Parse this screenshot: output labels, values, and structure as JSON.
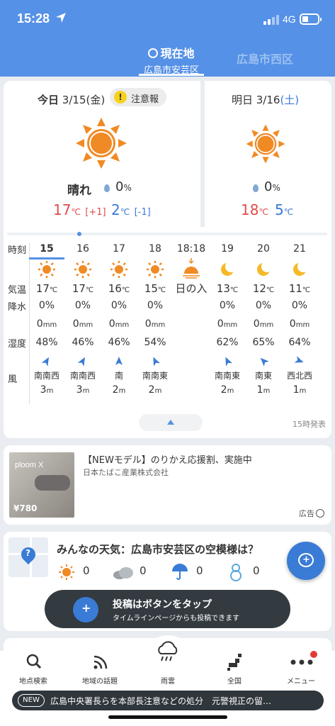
{
  "status": {
    "time": "15:28",
    "network": "4G"
  },
  "header": {
    "current_tab_title": "現在地",
    "current_tab_sub": "広島市安芸区",
    "other_tab": "広島市西区"
  },
  "today": {
    "label_bold": "今日",
    "label_date": "3/15",
    "label_dow": "(金)",
    "warning": "注意報",
    "weather": "晴れ",
    "precip": "0",
    "precip_unit": "%",
    "tmax": "17",
    "tmax_diff": "[+1]",
    "tmin": "2",
    "tmin_diff": "[-1]",
    "deg": "℃"
  },
  "tomorrow": {
    "label_prefix": "明日 3/16",
    "label_dow": "(土)",
    "precip": "0",
    "precip_unit": "%",
    "tmax": "18",
    "tmin": "5",
    "deg": "℃"
  },
  "row_labels": {
    "time": "時刻",
    "temp": "気温",
    "precip": "降水",
    "humidity": "湿度",
    "wind": "風"
  },
  "hours": [
    {
      "time": "15",
      "icon": "sun-icon",
      "temp": "17",
      "precip": "0%",
      "rain": "0",
      "humidity": "48%",
      "wind_dir": "南南西",
      "wind_speed": "3",
      "arrow_deg": 30
    },
    {
      "time": "16",
      "icon": "sun-icon",
      "temp": "17",
      "precip": "0%",
      "rain": "0",
      "humidity": "46%",
      "wind_dir": "南南西",
      "wind_speed": "3",
      "arrow_deg": 30
    },
    {
      "time": "17",
      "icon": "sun-icon",
      "temp": "16",
      "precip": "0%",
      "rain": "0",
      "humidity": "46%",
      "wind_dir": "南",
      "wind_speed": "2",
      "arrow_deg": 0
    },
    {
      "time": "18",
      "icon": "sun-icon",
      "temp": "15",
      "precip": "0%",
      "rain": "0",
      "humidity": "54%",
      "wind_dir": "南南東",
      "wind_speed": "2",
      "arrow_deg": -25
    },
    {
      "time": "18:18",
      "icon": "sunset-icon",
      "sunset_label": "日の入"
    },
    {
      "time": "19",
      "icon": "moon-icon",
      "temp": "13",
      "precip": "0%",
      "rain": "0",
      "humidity": "62%",
      "wind_dir": "南南東",
      "wind_speed": "2",
      "arrow_deg": -25
    },
    {
      "time": "20",
      "icon": "moon-icon",
      "temp": "12",
      "precip": "0%",
      "rain": "0",
      "humidity": "65%",
      "wind_dir": "南東",
      "wind_speed": "1",
      "arrow_deg": -45
    },
    {
      "time": "21",
      "icon": "moon-icon",
      "temp": "11",
      "precip": "0%",
      "rain": "0",
      "humidity": "64%",
      "wind_dir": "西北西",
      "wind_speed": "1",
      "arrow_deg": 110
    }
  ],
  "units": {
    "deg": "℃",
    "mm": "mm",
    "m": "m"
  },
  "issued": "15時発表",
  "ad": {
    "title": "【NEWモデル】のりかえ応援割、実施中",
    "sponsor": "日本たばこ産業株式会社",
    "tag": "広告",
    "img_logo": "ploom X",
    "img_price": "¥780"
  },
  "community": {
    "title": "みんなの天気：広島市安芸区の空模様は？",
    "votes": [
      {
        "icon": "sun-icon",
        "count": "0"
      },
      {
        "icon": "cloud-icon",
        "count": "0"
      },
      {
        "icon": "umbrella-icon",
        "count": "0"
      },
      {
        "icon": "snowman-icon",
        "count": "0"
      }
    ]
  },
  "tooltip": {
    "title": "投稿はボタンをタップ",
    "sub": "タイムラインページからも投稿できます"
  },
  "tabs": [
    {
      "label": "地点検索",
      "icon": "search-icon"
    },
    {
      "label": "地域の話題",
      "icon": "rss-icon"
    },
    {
      "label": "雨雲",
      "icon": "rain-cloud-icon"
    },
    {
      "label": "全国",
      "icon": "japan-map-icon"
    },
    {
      "label": "メニュー",
      "icon": "more-icon"
    }
  ],
  "news": {
    "badge": "NEW",
    "text": "広島中央署長らを本部長注意などの処分　元警視正の留…"
  },
  "colors": {
    "accent": "#5591e6",
    "sun": "#f08a24",
    "hot": "#e04b4b",
    "cold": "#3a7bd5"
  }
}
